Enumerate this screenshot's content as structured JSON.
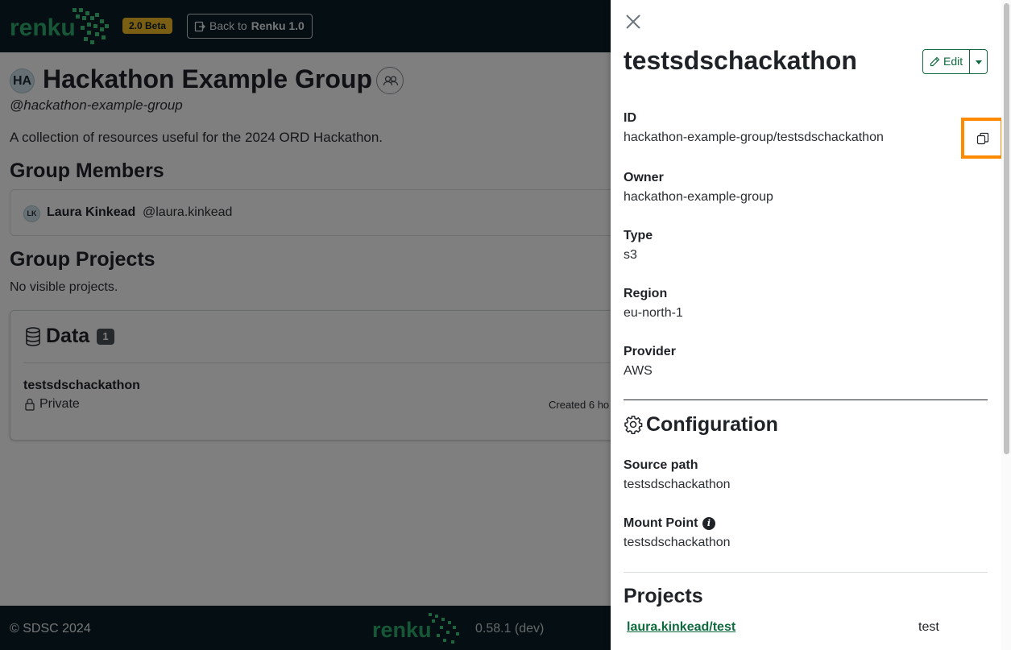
{
  "header": {
    "brand": "renku",
    "beta_badge": "2.0 Beta",
    "back_prefix": "Back to",
    "back_target": "Renku 1.0"
  },
  "group": {
    "initials": "HA",
    "title": "Hackathon Example Group",
    "handle": "@hackathon-example-group",
    "description": "A collection of resources useful for the 2024 ORD Hackathon.",
    "members_heading": "Group Members",
    "members": [
      {
        "initials": "LK",
        "name": "Laura Kinkead",
        "username": "@laura.kinkead"
      }
    ],
    "projects_heading": "Group Projects",
    "no_projects": "No visible projects."
  },
  "data_section": {
    "heading": "Data",
    "count": "1",
    "items": [
      {
        "name": "testsdschackathon",
        "visibility": "Private",
        "created": "Created 6 ho"
      }
    ]
  },
  "footer": {
    "copyright": "© SDSC 2024",
    "version": "0.58.1 (dev)"
  },
  "panel": {
    "title": "testsdschackathon",
    "edit_label": "Edit",
    "fields": {
      "id": {
        "label": "ID",
        "value": "hackathon-example-group/testsdschackathon"
      },
      "owner": {
        "label": "Owner",
        "value": "hackathon-example-group"
      },
      "type": {
        "label": "Type",
        "value": "s3"
      },
      "region": {
        "label": "Region",
        "value": "eu-north-1"
      },
      "provider": {
        "label": "Provider",
        "value": "AWS"
      }
    },
    "configuration": {
      "heading": "Configuration",
      "source_path": {
        "label": "Source path",
        "value": "testsdschackathon"
      },
      "mount_point": {
        "label": "Mount Point",
        "value": "testsdschackathon"
      }
    },
    "projects": {
      "heading": "Projects",
      "items": [
        {
          "path": "laura.kinkead/test",
          "name": "test"
        }
      ]
    }
  },
  "colors": {
    "brand_dark": "#0b1f27",
    "accent_green": "#0f6b3d",
    "beta_yellow": "#f2bc27",
    "highlight_orange": "#ff8a00"
  }
}
